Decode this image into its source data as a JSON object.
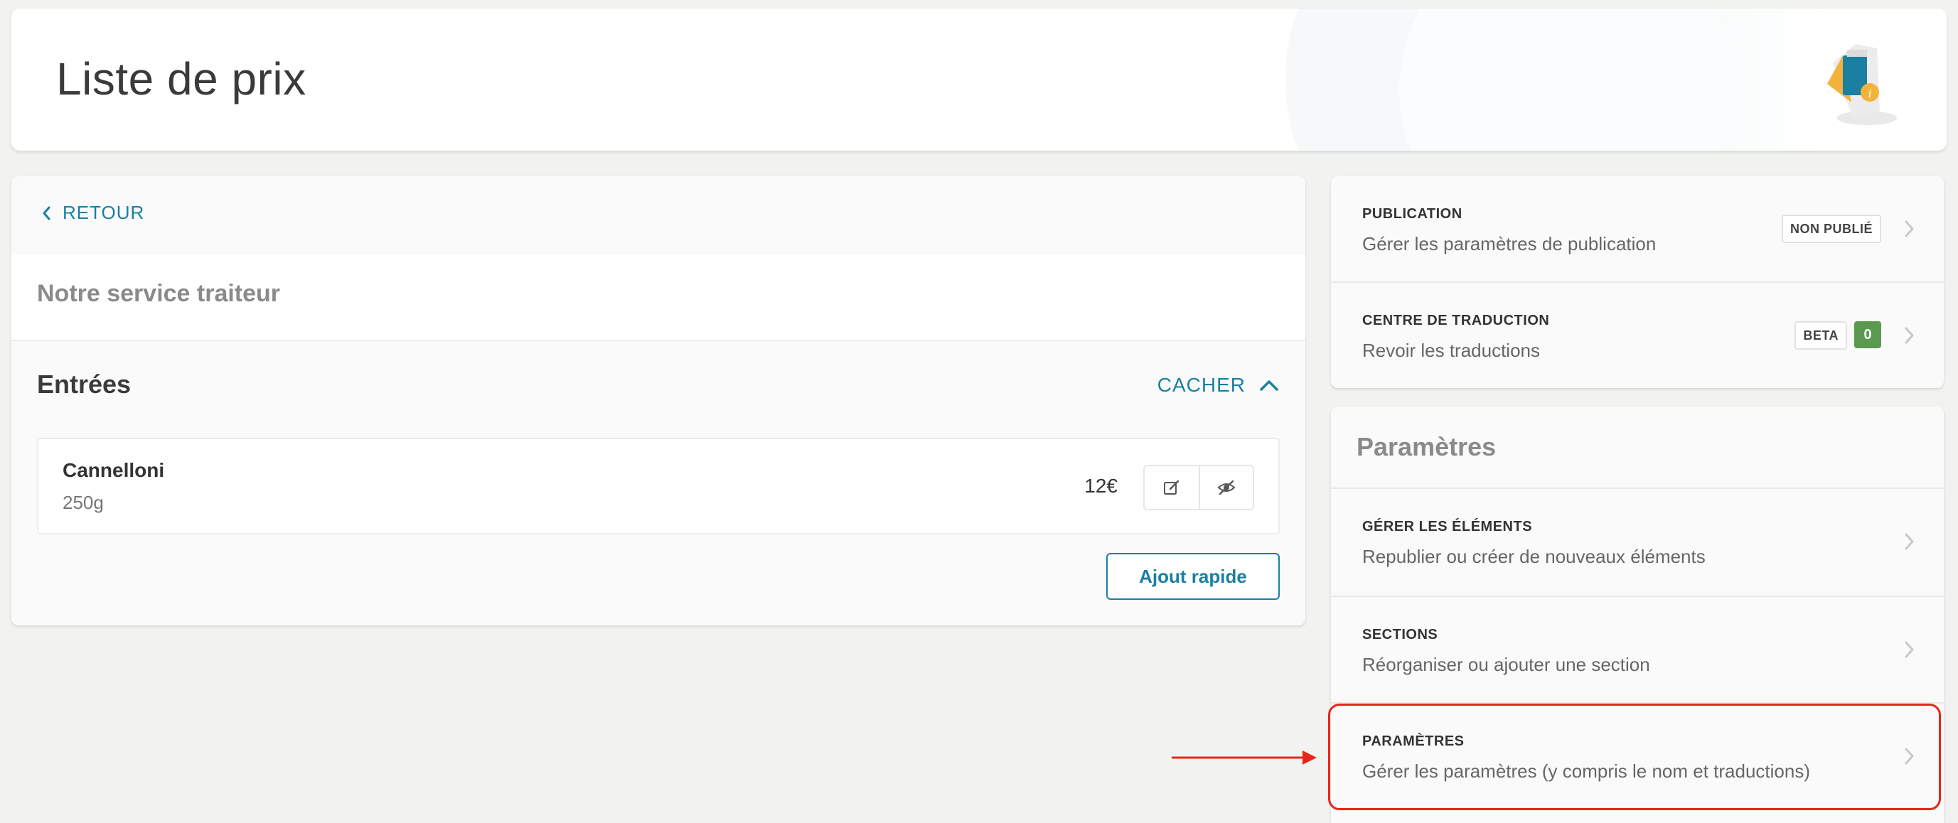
{
  "header": {
    "title": "Liste de prix"
  },
  "left": {
    "back_label": "RETOUR",
    "list_name": "Notre service traiteur",
    "section": {
      "title": "Entrées",
      "toggle_label": "CACHER"
    },
    "items": [
      {
        "name": "Cannelloni",
        "description": "250g",
        "price": "12€"
      }
    ],
    "quick_add_label": "Ajout rapide"
  },
  "publication_card": {
    "rows": [
      {
        "label": "PUBLICATION",
        "description": "Gérer les paramètres de publication",
        "badge": "NON PUBLIÉ"
      },
      {
        "label": "CENTRE DE TRADUCTION",
        "description": "Revoir les traductions",
        "badge": "BETA",
        "count": "0"
      }
    ]
  },
  "params_card": {
    "title": "Paramètres",
    "rows": [
      {
        "label": "GÉRER LES ÉLÉMENTS",
        "description": "Republier ou créer de nouveaux éléments"
      },
      {
        "label": "SECTIONS",
        "description": "Réorganiser ou ajouter une section"
      },
      {
        "label": "PARAMÈTRES",
        "description": "Gérer les paramètres (y compris le nom et traductions)"
      }
    ]
  },
  "colors": {
    "accent": "#1a7fa0",
    "success": "#5a9a4e",
    "annotation": "#e8261a"
  }
}
